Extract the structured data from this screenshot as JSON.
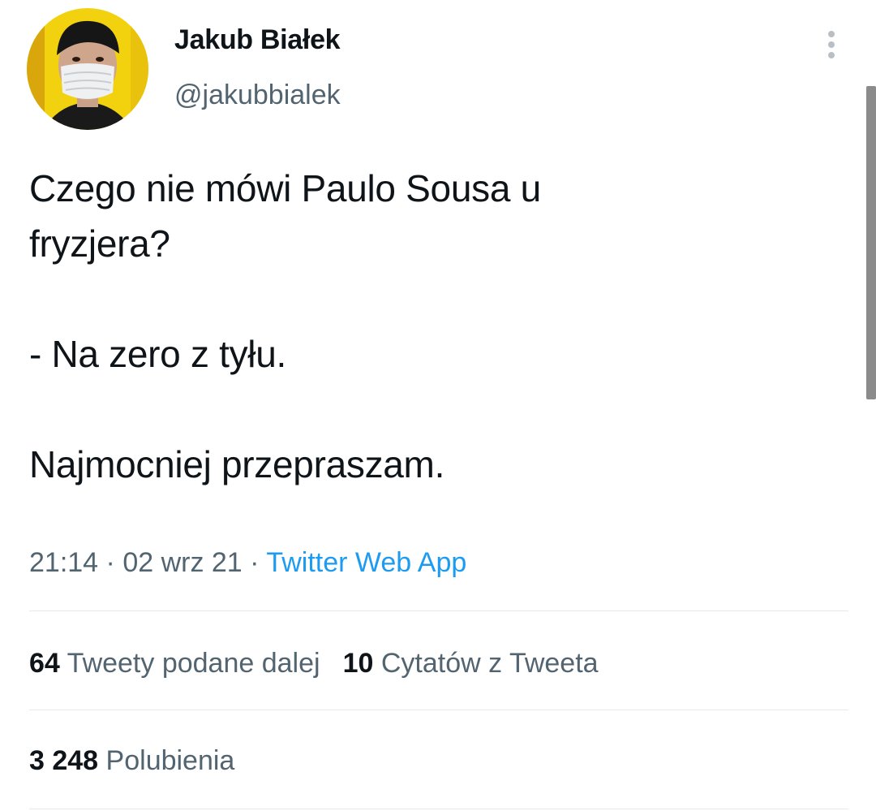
{
  "author": {
    "display_name": "Jakub Białek",
    "handle": "@jakubbialek"
  },
  "icons": {
    "more": "more-vertical-icon"
  },
  "tweet": {
    "text": "Czego nie mówi Paulo Sousa u\nfryzjera?\n\n- Na zero z tyłu.\n\nNajmocniej przepraszam.",
    "time": "21:14",
    "separator": " · ",
    "date": "02 wrz 21",
    "source": "Twitter Web App"
  },
  "stats": {
    "retweets_count": "64",
    "retweets_label": "Tweety podane dalej",
    "quotes_count": "10",
    "quotes_label": "Cytatów z Tweeta",
    "likes_count": "3 248",
    "likes_label": "Polubienia"
  },
  "colors": {
    "text_primary": "#0f1419",
    "text_secondary": "#536471",
    "link": "#1d9bf0",
    "avatar_background": "#f2d20f"
  }
}
